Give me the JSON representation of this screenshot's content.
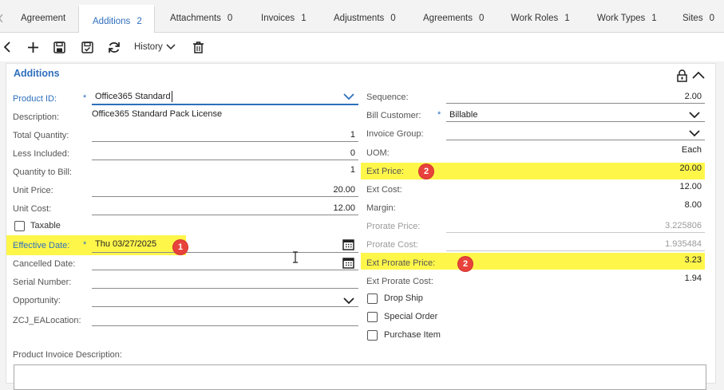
{
  "tabs": [
    {
      "label": "Agreement",
      "count": ""
    },
    {
      "label": "Additions",
      "count": "2"
    },
    {
      "label": "Attachments",
      "count": "0"
    },
    {
      "label": "Invoices",
      "count": "1"
    },
    {
      "label": "Adjustments",
      "count": "0"
    },
    {
      "label": "Agreements",
      "count": "0"
    },
    {
      "label": "Work Roles",
      "count": "1"
    },
    {
      "label": "Work Types",
      "count": "1"
    },
    {
      "label": "Sites",
      "count": "0"
    }
  ],
  "toolbar": {
    "history_label": "History"
  },
  "panel": {
    "title": "Additions"
  },
  "left": {
    "product_id": {
      "label": "Product ID:",
      "value": "Office365 Standard"
    },
    "description": {
      "label": "Description:",
      "value": "Office365 Standard Pack License"
    },
    "total_quantity": {
      "label": "Total Quantity:",
      "value": "1"
    },
    "less_included": {
      "label": "Less Included:",
      "value": "0"
    },
    "quantity_to_bill": {
      "label": "Quantity to Bill:",
      "value": "1"
    },
    "unit_price": {
      "label": "Unit Price:",
      "value": "20.00"
    },
    "unit_cost": {
      "label": "Unit Cost:",
      "value": "12.00"
    },
    "taxable": {
      "label": "Taxable"
    },
    "effective_date": {
      "label": "Effective Date:",
      "value": "Thu 03/27/2025"
    },
    "cancelled_date": {
      "label": "Cancelled Date:",
      "value": ""
    },
    "serial_number": {
      "label": "Serial Number:",
      "value": ""
    },
    "opportunity": {
      "label": "Opportunity:",
      "value": ""
    },
    "zcj_ealocation": {
      "label": "ZCJ_EALocation:",
      "value": ""
    },
    "product_invoice_description": {
      "label": "Product Invoice Description:"
    }
  },
  "right": {
    "sequence": {
      "label": "Sequence:",
      "value": "2.00"
    },
    "bill_customer": {
      "label": "Bill Customer:",
      "value": "Billable"
    },
    "invoice_group": {
      "label": "Invoice Group:",
      "value": ""
    },
    "uom": {
      "label": "UOM:",
      "value": "Each"
    },
    "ext_price": {
      "label": "Ext Price:",
      "value": "20.00"
    },
    "ext_cost": {
      "label": "Ext Cost:",
      "value": "12.00"
    },
    "margin": {
      "label": "Margin:",
      "value": "8.00"
    },
    "prorate_price": {
      "label": "Prorate Price:",
      "value": "3.225806"
    },
    "prorate_cost": {
      "label": "Prorate Cost:",
      "value": "1.935484"
    },
    "ext_prorate_price": {
      "label": "Ext Prorate Price:",
      "value": "3.23"
    },
    "ext_prorate_cost": {
      "label": "Ext Prorate Cost:",
      "value": "1.94"
    },
    "drop_ship": {
      "label": "Drop Ship"
    },
    "special_order": {
      "label": "Special Order"
    },
    "purchase_item": {
      "label": "Purchase Item"
    }
  },
  "annotations": {
    "badge1": "1",
    "badge2a": "2",
    "badge2b": "2"
  },
  "colors": {
    "highlight": "#fff64a",
    "badge": "#e8423c",
    "accent": "#2e6fbd"
  }
}
